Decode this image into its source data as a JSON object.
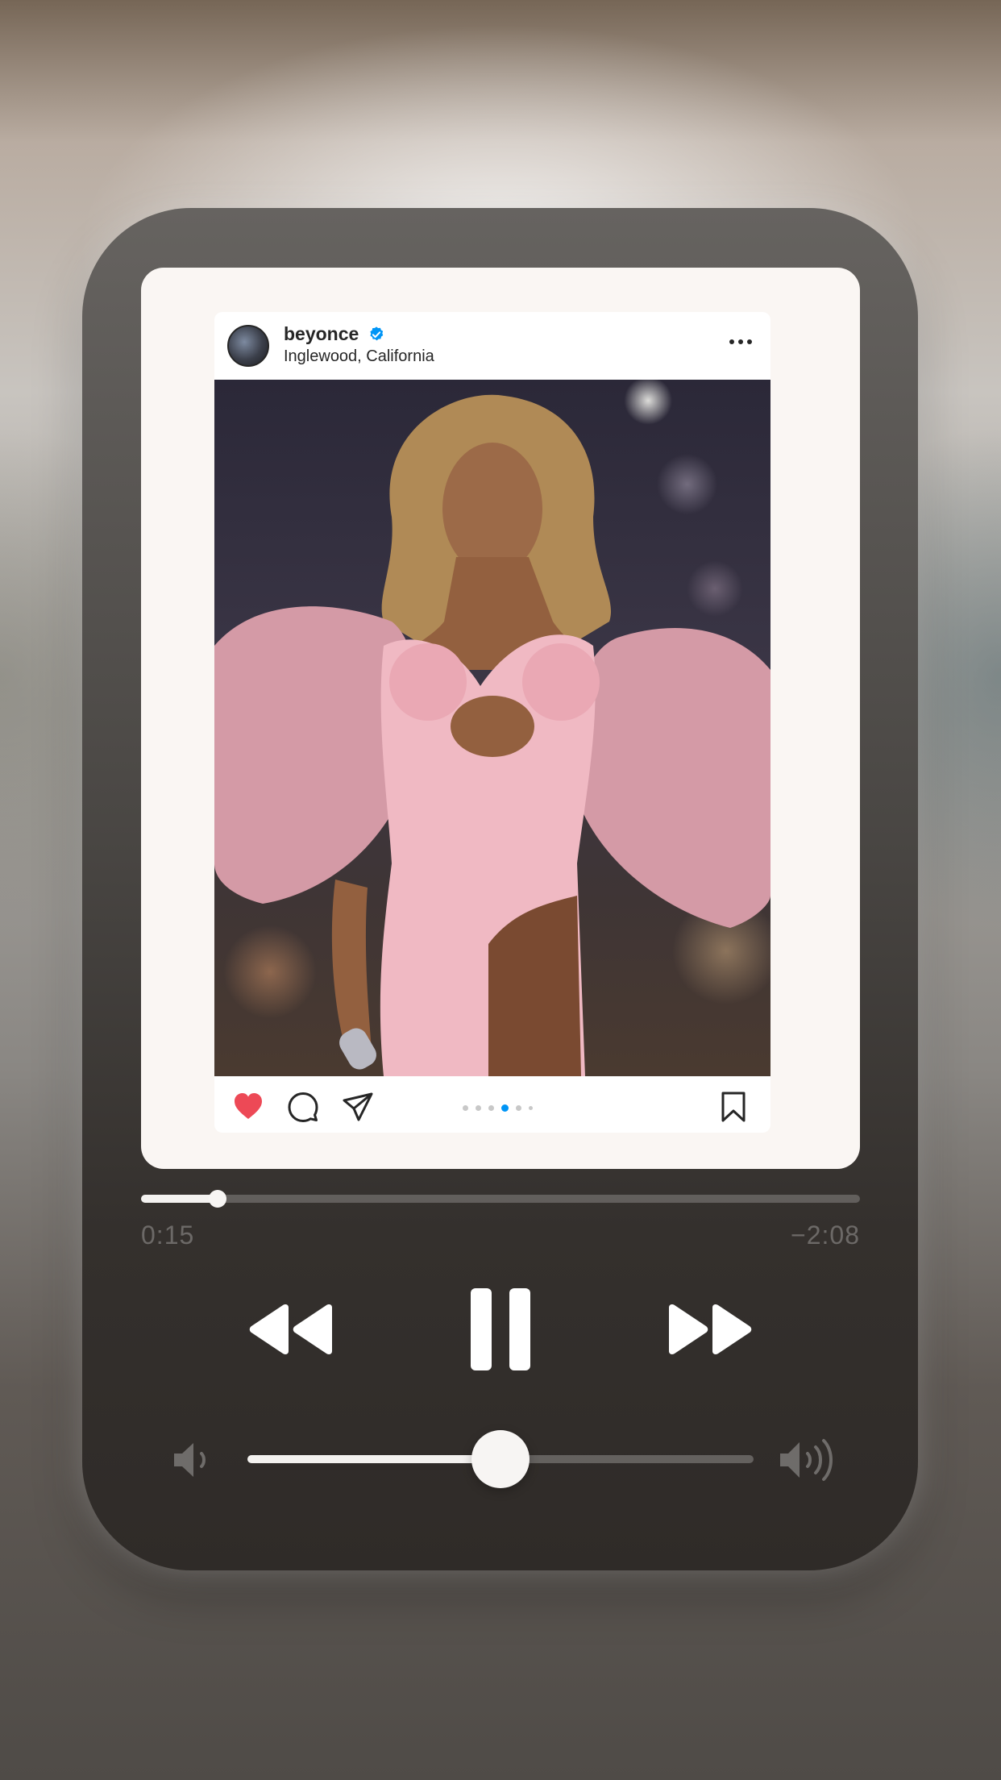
{
  "post": {
    "username": "beyonce",
    "location": "Inglewood, California",
    "verified": true,
    "liked": true,
    "carousel": {
      "count": 6,
      "active_index": 3
    },
    "colors": {
      "like": "#ed4956",
      "verified": "#0095f6",
      "active_dot": "#0095f6"
    }
  },
  "icons": {
    "avatar": "profile-avatar",
    "verified": "verified-badge-icon",
    "more": "more-options-icon",
    "like": "heart-icon",
    "comment": "comment-icon",
    "share": "share-icon",
    "save": "bookmark-icon",
    "rewind": "rewind-icon",
    "pause": "pause-icon",
    "forward": "fast-forward-icon",
    "volume_low": "volume-low-icon",
    "volume_high": "volume-high-icon"
  },
  "playback": {
    "elapsed": "0:15",
    "remaining": "−2:08",
    "progress": 0.106,
    "state": "playing"
  },
  "volume": {
    "level": 0.5
  }
}
